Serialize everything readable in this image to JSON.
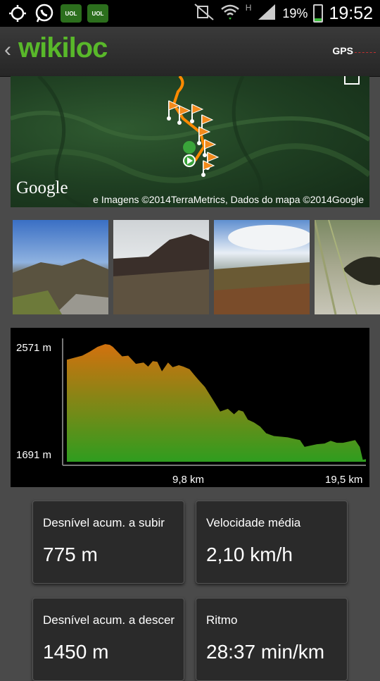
{
  "status_bar": {
    "battery_text": "19%",
    "battery_level": 0.19,
    "time": "19:52",
    "network_letter": "H",
    "app_badge": "UOL"
  },
  "header": {
    "logo": "wikiloc",
    "gps_label": "GPS"
  },
  "map": {
    "provider": "Google",
    "attribution": "e   Imagens ©2014TerraMetrics, Dados do mapa ©2014Google"
  },
  "photos": [
    {
      "name": "photo-1"
    },
    {
      "name": "photo-2"
    },
    {
      "name": "photo-3"
    },
    {
      "name": "photo-4"
    }
  ],
  "chart_data": {
    "type": "area",
    "title": "",
    "xlabel": "",
    "ylabel": "",
    "y_ticks": [
      "2571 m",
      "1691 m"
    ],
    "x_ticks": [
      "9,8 km",
      "19,5 km"
    ],
    "ylim": [
      1691,
      2571
    ],
    "xlim": [
      0,
      19.5
    ],
    "x": [
      0,
      0.5,
      1.0,
      1.5,
      2.0,
      2.5,
      2.8,
      3.0,
      3.3,
      3.6,
      4.0,
      4.5,
      5.0,
      5.3,
      5.6,
      5.9,
      6.2,
      6.6,
      6.9,
      7.3,
      7.6,
      8.0,
      8.3,
      8.6,
      9.0,
      9.5,
      10.0,
      10.5,
      10.9,
      11.2,
      11.5,
      11.8,
      12.2,
      12.6,
      13.0,
      13.5,
      14.0,
      14.4,
      14.8,
      15.2,
      15.5,
      15.9,
      16.3,
      16.8,
      17.2,
      17.6,
      18.0,
      18.4,
      18.8,
      19.1,
      19.3,
      19.5
    ],
    "y": [
      2440,
      2455,
      2470,
      2500,
      2535,
      2555,
      2550,
      2535,
      2500,
      2465,
      2470,
      2410,
      2420,
      2390,
      2430,
      2425,
      2355,
      2420,
      2385,
      2400,
      2390,
      2370,
      2330,
      2290,
      2240,
      2150,
      2060,
      2080,
      2040,
      2070,
      2060,
      2000,
      1980,
      1950,
      1900,
      1880,
      1875,
      1870,
      1860,
      1850,
      1800,
      1810,
      1820,
      1825,
      1845,
      1830,
      1830,
      1840,
      1850,
      1800,
      1705,
      1710
    ],
    "grid": false,
    "fill_colors": [
      "#d2710e",
      "#2f9d1f"
    ]
  },
  "stats": [
    {
      "label": "Desnível acum. a subir",
      "value": "775 m"
    },
    {
      "label": "Velocidade média",
      "value": "2,10 km/h"
    },
    {
      "label": "Desnível acum. a descer",
      "value": "1450 m"
    },
    {
      "label": "Ritmo",
      "value": "28:37 min/km"
    }
  ]
}
